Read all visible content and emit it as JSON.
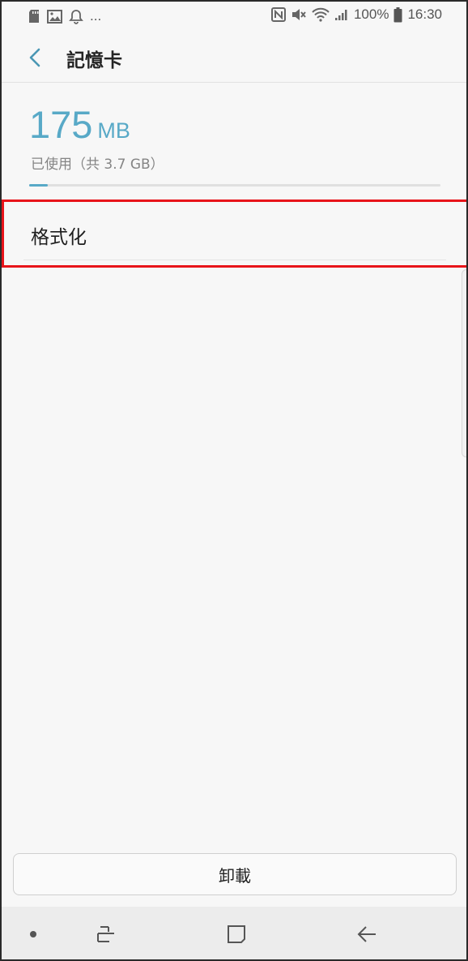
{
  "status_bar": {
    "left_icons": [
      "sd-card-icon",
      "image-icon",
      "bell-icon"
    ],
    "more": "...",
    "battery": "100%",
    "time": "16:30"
  },
  "header": {
    "title": "記憶卡"
  },
  "storage": {
    "used_value": "175",
    "used_unit": "MB",
    "caption": "已使用（共 3.7 GB）",
    "used_fraction": 0.046
  },
  "menu": {
    "format_label": "格式化"
  },
  "actions": {
    "unmount_label": "卸載"
  },
  "colors": {
    "accent": "#58a9c7",
    "highlight": "#e8141a",
    "background": "#f7f7f7"
  }
}
